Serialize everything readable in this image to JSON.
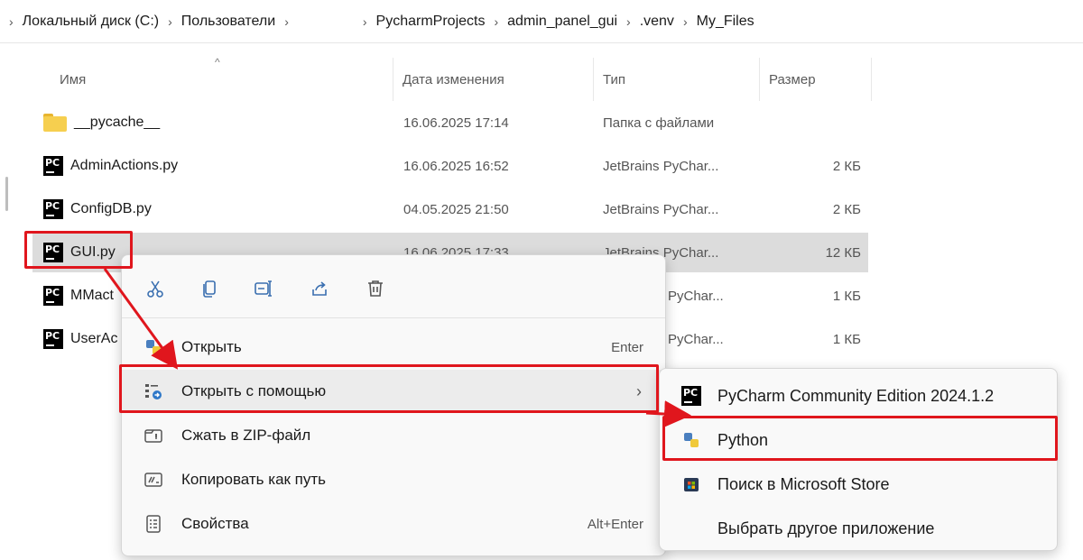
{
  "breadcrumb": {
    "segments": [
      "Локальный диск (C:)",
      "Пользователи",
      "PycharmProjects",
      "admin_panel_gui",
      ".venv",
      "My_Files"
    ]
  },
  "columns": {
    "name": "Имя",
    "date": "Дата изменения",
    "type": "Тип",
    "size": "Размер"
  },
  "files": [
    {
      "name": "__pycache__",
      "date": "16.06.2025 17:14",
      "type": "Папка с файлами",
      "size": "",
      "icon": "folder-icon"
    },
    {
      "name": "AdminActions.py",
      "date": "16.06.2025 16:52",
      "type": "JetBrains PyChar...",
      "size": "2 КБ",
      "icon": "pycharm-file-icon"
    },
    {
      "name": "ConfigDB.py",
      "date": "04.05.2025 21:50",
      "type": "JetBrains PyChar...",
      "size": "2 КБ",
      "icon": "pycharm-file-icon"
    },
    {
      "name": "GUI.py",
      "date": "16.06.2025 17:33",
      "type": "JetBrains PyChar...",
      "size": "12 КБ",
      "icon": "pycharm-file-icon"
    },
    {
      "name": "MMact",
      "date": "",
      "type": "PyChar...",
      "size": "1 КБ",
      "icon": "pycharm-file-icon"
    },
    {
      "name": "UserAc",
      "date": "",
      "type": "PyChar...",
      "size": "1 КБ",
      "icon": "pycharm-file-icon"
    }
  ],
  "context_menu": {
    "toolbar": [
      "cut-icon",
      "copy-icon",
      "rename-icon",
      "share-icon",
      "delete-icon"
    ],
    "items": [
      {
        "label": "Открыть",
        "shortcut": "Enter",
        "icon": "python-open-icon"
      },
      {
        "label": "Открыть с помощью",
        "shortcut": "",
        "icon": "open-with-icon",
        "has_submenu": true
      },
      {
        "label": "Сжать в ZIP-файл",
        "shortcut": "",
        "icon": "zip-icon"
      },
      {
        "label": "Копировать как путь",
        "shortcut": "",
        "icon": "copy-path-icon"
      },
      {
        "label": "Свойства",
        "shortcut": "Alt+Enter",
        "icon": "properties-icon"
      }
    ]
  },
  "submenu": {
    "items": [
      {
        "label": "PyCharm Community Edition 2024.1.2",
        "icon": "pycharm-icon"
      },
      {
        "label": "Python",
        "icon": "python-icon"
      },
      {
        "label": "Поиск в Microsoft Store",
        "icon": "store-icon"
      },
      {
        "label": "Выбрать другое приложение",
        "icon": ""
      }
    ]
  },
  "colors": {
    "highlight_red": "#e0161d",
    "selection": "#dcdcdc",
    "accent_blue": "#3a6fb0",
    "folder_yellow": "#f6cf4f"
  }
}
